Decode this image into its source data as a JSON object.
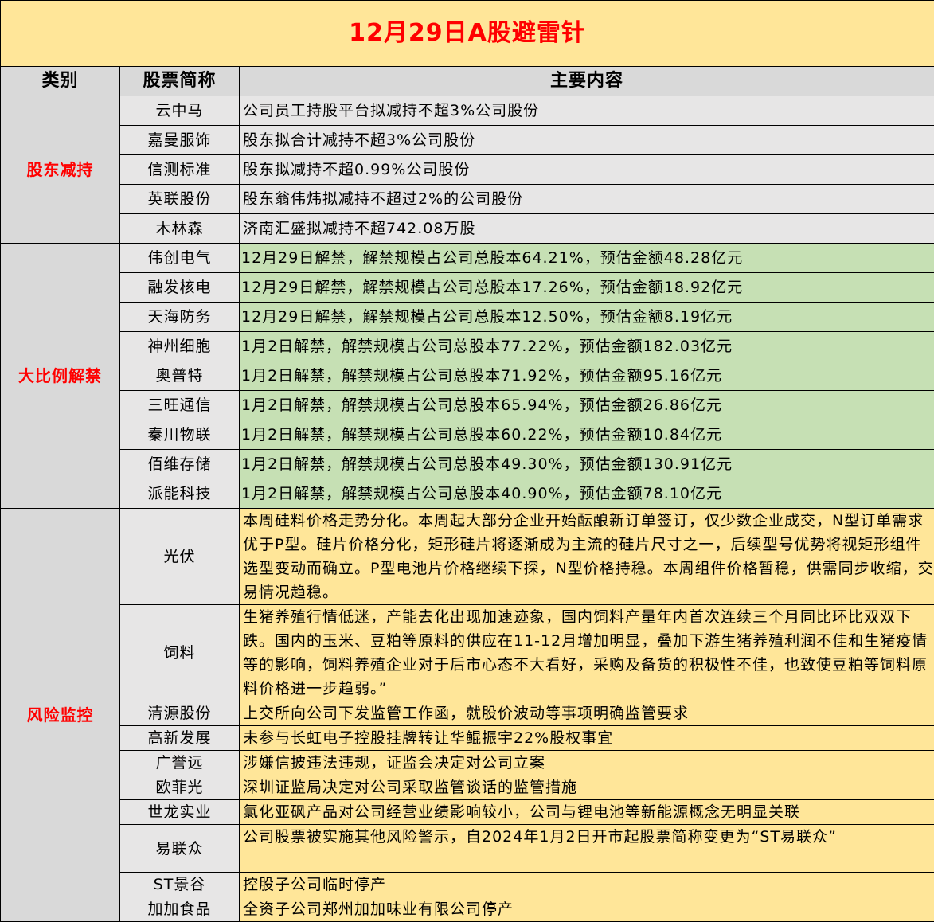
{
  "title": "12月29日A股避雷针",
  "headers": {
    "category": "类别",
    "name": "股票简称",
    "content": "主要内容"
  },
  "groups": [
    {
      "category": "股东减持",
      "rows": [
        {
          "name": "云中马",
          "content": "公司员工持股平台拟减持不超3%公司股份"
        },
        {
          "name": "嘉曼服饰",
          "content": "股东拟合计减持不超3%公司股份"
        },
        {
          "name": "信测标准",
          "content": "股东拟减持不超0.99%公司股份"
        },
        {
          "name": "英联股份",
          "content": "股东翁伟炜拟减持不超过2%的公司股份"
        },
        {
          "name": "木林森",
          "content": "济南汇盛拟减持不超742.08万股"
        }
      ]
    },
    {
      "category": "大比例解禁",
      "rows": [
        {
          "name": "伟创电气",
          "content": "12月29日解禁，解禁规模占公司总股本64.21%，预估金额48.28亿元"
        },
        {
          "name": "融发核电",
          "content": "12月29日解禁，解禁规模占公司总股本17.26%，预估金额18.92亿元"
        },
        {
          "name": "天海防务",
          "content": "12月29日解禁，解禁规模占公司总股本12.50%，预估金额8.19亿元"
        },
        {
          "name": "神州细胞",
          "content": "1月2日解禁，解禁规模占公司总股本77.22%，预估金额182.03亿元"
        },
        {
          "name": "奥普特",
          "content": "1月2日解禁，解禁规模占公司总股本71.92%，预估金额95.16亿元"
        },
        {
          "name": "三旺通信",
          "content": "1月2日解禁，解禁规模占公司总股本65.94%，预估金额26.86亿元"
        },
        {
          "name": "秦川物联",
          "content": "1月2日解禁，解禁规模占公司总股本60.22%，预估金额10.84亿元"
        },
        {
          "name": "佰维存储",
          "content": "1月2日解禁，解禁规模占公司总股本49.30%，预估金额130.91亿元"
        },
        {
          "name": "派能科技",
          "content": "1月2日解禁，解禁规模占公司总股本40.90%，预估金额78.10亿元"
        }
      ]
    },
    {
      "category": "风险监控",
      "rows": [
        {
          "name": "光伏",
          "content": "本周硅料价格走势分化。本周起大部分企业开始酝酿新订单签订，仅少数企业成交，N型订单需求优于P型。硅片价格分化，矩形硅片将逐渐成为主流的硅片尺寸之一，后续型号优势将视矩形组件选型变动而确立。P型电池片价格继续下探，N型价格持稳。本周组件价格暂稳，供需同步收缩，交易情况趋稳。"
        },
        {
          "name": "饲料",
          "content": "生猪养殖行情低迷，产能去化出现加速迹象，国内饲料产量年内首次连续三个月同比环比双双下跌。国内的玉米、豆粕等原料的供应在11-12月增加明显，叠加下游生猪养殖利润不佳和生猪疫情等的影响，饲料养殖企业对于后市心态不大看好，采购及备货的积极性不佳，也致使豆粕等饲料原料价格进一步趋弱。”"
        },
        {
          "name": "清源股份",
          "content": "上交所向公司下发监管工作函，就股价波动等事项明确监管要求"
        },
        {
          "name": "高新发展",
          "content": "未参与长虹电子控股挂牌转让华鲲振宇22%股权事宜"
        },
        {
          "name": "广誉远",
          "content": "涉嫌信披违法违规，证监会决定对公司立案"
        },
        {
          "name": "欧菲光",
          "content": "深圳证监局决定对公司采取监管谈话的监管措施"
        },
        {
          "name": "世龙实业",
          "content": "氯化亚砜产品对公司经营业绩影响较小，公司与锂电池等新能源概念无明显关联"
        },
        {
          "name": "易联众",
          "content": "公司股票被实施其他风险警示，自2024年1月2日开市起股票简称变更为“ST易联众”"
        },
        {
          "name": "ST景谷",
          "content": "控股子公司临时停产"
        },
        {
          "name": "加加食品",
          "content": "全资子公司郑州加加味业有限公司停产"
        }
      ]
    }
  ]
}
